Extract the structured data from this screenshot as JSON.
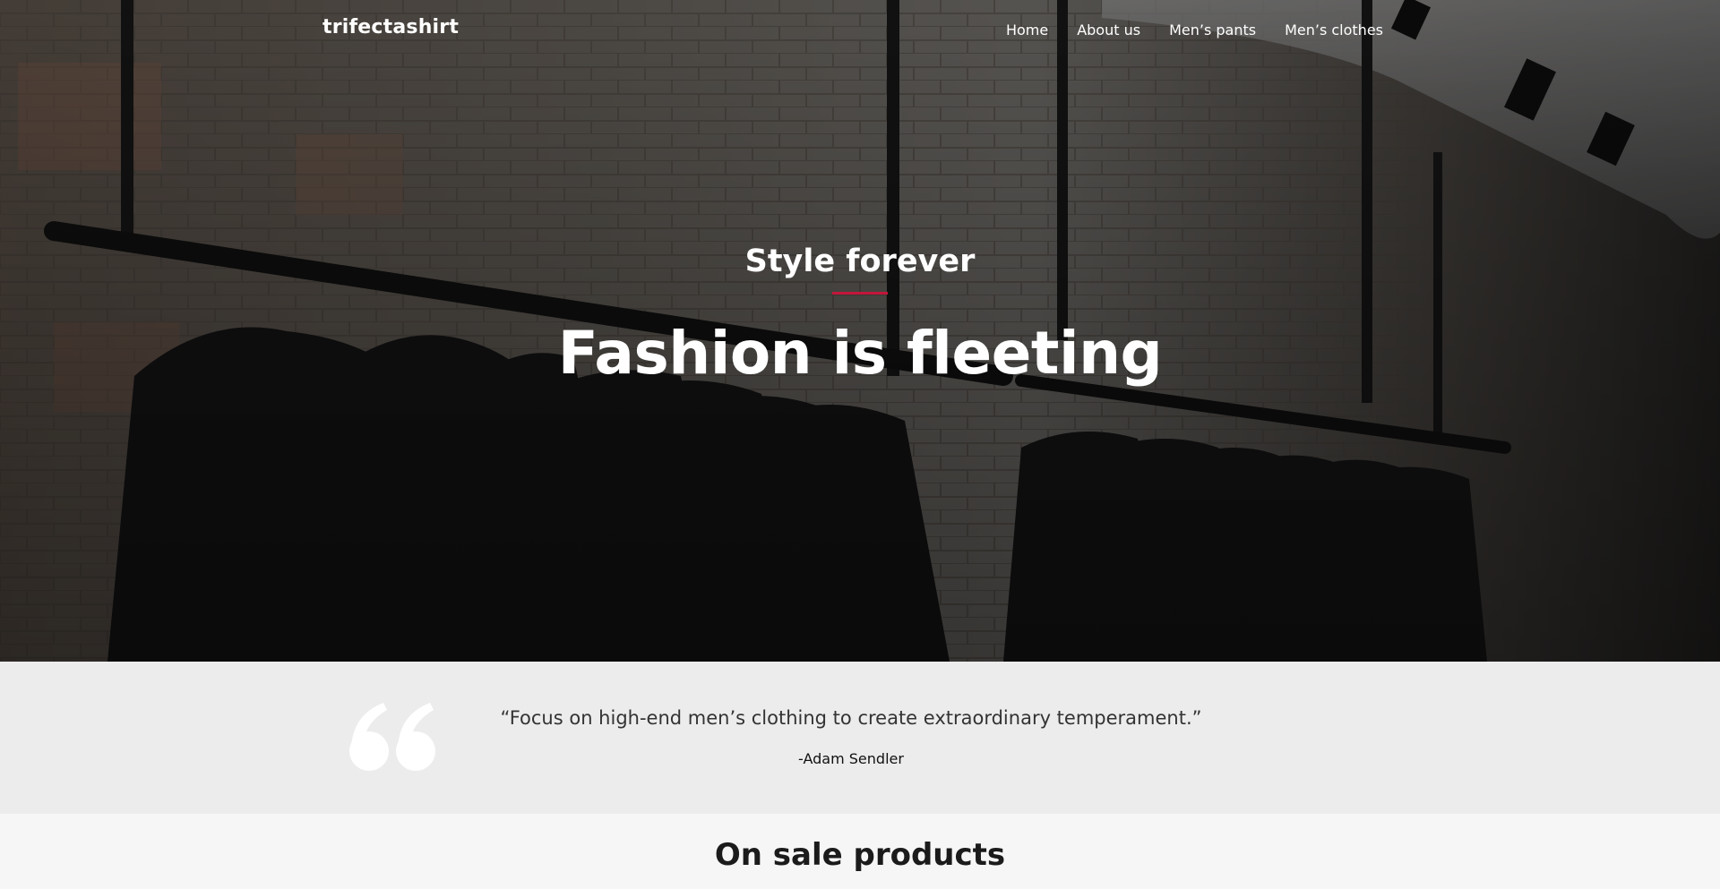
{
  "header": {
    "brand": "trifectashirt",
    "nav": [
      {
        "label": "Home"
      },
      {
        "label": "About us"
      },
      {
        "label": "Men’s pants"
      },
      {
        "label": "Men’s clothes"
      }
    ]
  },
  "hero": {
    "kicker": "Style forever",
    "title": "Fashion is fleeting",
    "accent_color": "#c4163b",
    "background_image": "clothing-rack-photo"
  },
  "quote": {
    "icon": "quote-icon",
    "text": "“Focus on high-end men’s clothing to create extraordinary temperament.”",
    "author": "-Adam Sendler"
  },
  "sale": {
    "title": "On sale products"
  }
}
